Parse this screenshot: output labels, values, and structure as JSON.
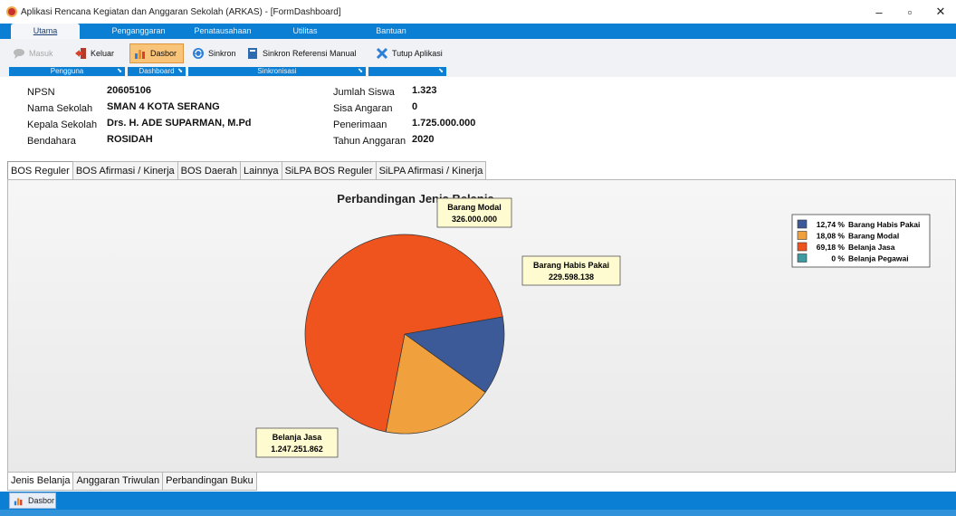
{
  "window": {
    "title": "Aplikasi Rencana Kegiatan dan Anggaran Sekolah (ARKAS) - [FormDashboard]",
    "minimize": "–",
    "maximize": "▫",
    "close": "✕"
  },
  "ribbon": {
    "tabs": [
      "Utama",
      "Penganggaran",
      "Penatausahaan",
      "Utilitas",
      "Bantuan"
    ],
    "active_tab": "Utama",
    "groups": {
      "pengguna": {
        "caption": "Pengguna",
        "buttons": [
          "Masuk",
          "Keluar"
        ]
      },
      "dashboard": {
        "caption": "Dashboard",
        "buttons": [
          "Dasbor"
        ]
      },
      "sinkronisasi": {
        "caption": "Sinkronisasi",
        "buttons": [
          "Sinkron",
          "Sinkron Referensi Manual"
        ]
      },
      "aplikasi": {
        "caption": "",
        "buttons": [
          "Tutup Aplikasi"
        ]
      }
    },
    "launcher": "⬊"
  },
  "school": {
    "npsn_label": "NPSN",
    "npsn": "20605106",
    "nama_label": "Nama Sekolah",
    "nama": "SMAN 4 KOTA SERANG",
    "kepala_label": "Kepala Sekolah",
    "kepala": "Drs. H. ADE SUPARMAN, M.Pd",
    "bendahara_label": "Bendahara",
    "bendahara": "ROSIDAH",
    "siswa_label": "Jumlah Siswa",
    "siswa": "1.323",
    "sisa_label": "Sisa Angaran",
    "sisa": "0",
    "penerimaan_label": "Penerimaan",
    "penerimaan": "1.725.000.000",
    "tahun_label": "Tahun Anggaran",
    "tahun": "2020"
  },
  "top_tabs": [
    "BOS Reguler",
    "BOS Afirmasi / Kinerja",
    "BOS Daerah",
    "Lainnya",
    "SiLPA BOS Reguler",
    "SiLPA Afirmasi / Kinerja"
  ],
  "bottom_tabs": [
    "Jenis Belanja",
    "Anggaran Triwulan",
    "Perbandingan Buku"
  ],
  "taskbar": {
    "item": "Dasbor"
  },
  "chart_data": {
    "type": "pie",
    "title": "Perbandingan Jenis Belanja",
    "series": [
      {
        "name": "Barang Habis Pakai",
        "value": 229598138,
        "value_label": "229.598.138",
        "percent_label": "12,74 %",
        "color": "#3d5a98"
      },
      {
        "name": "Barang Modal",
        "value": 326000000,
        "value_label": "326.000.000",
        "percent_label": "18,08 %",
        "color": "#f0a03c"
      },
      {
        "name": "Belanja Jasa",
        "value": 1247251862,
        "value_label": "1.247.251.862",
        "percent_label": "69,18 %",
        "color": "#f0541e"
      },
      {
        "name": "Belanja Pegawai",
        "value": 0,
        "value_label": "",
        "percent_label": "0 %",
        "color": "#3c9aa0"
      }
    ],
    "legend_position": "top-right"
  }
}
